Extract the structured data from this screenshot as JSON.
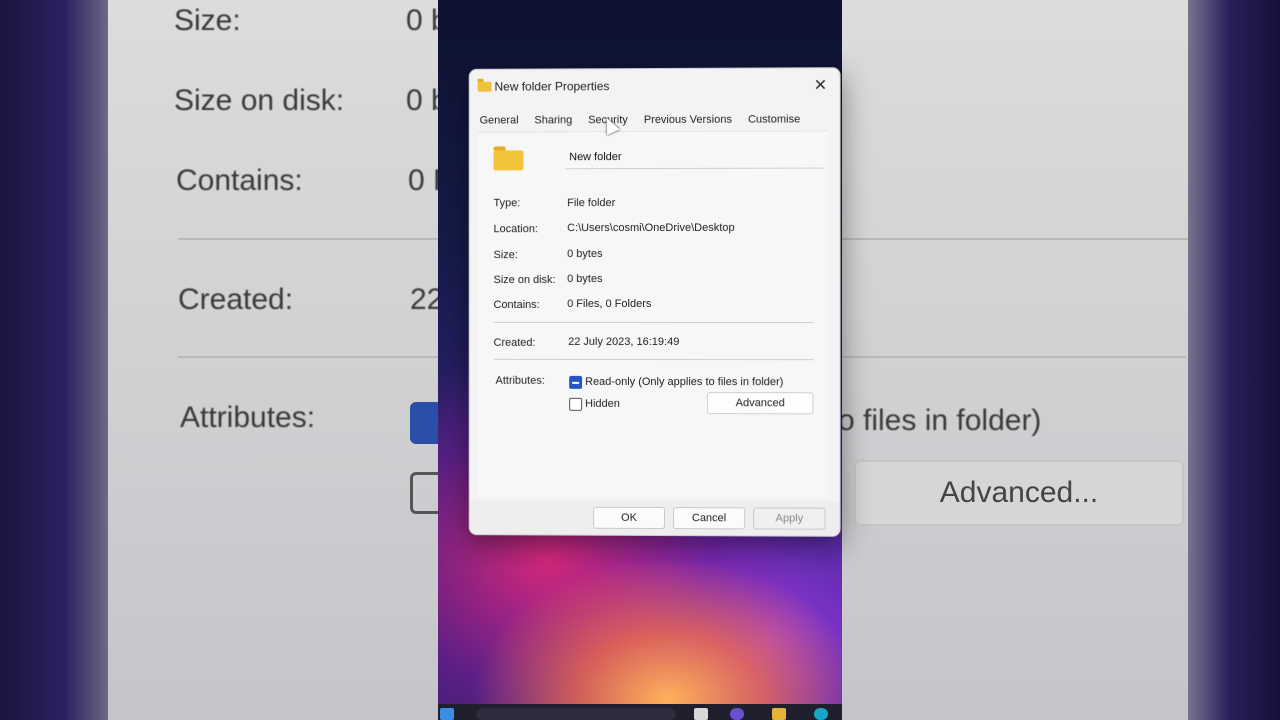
{
  "background_zoom": {
    "left": {
      "size_label": "Size:",
      "size_value": "0 b",
      "size_on_disk_label": "Size on disk:",
      "size_on_disk_value": "0 b",
      "contains_label": "Contains:",
      "contains_value": "0 F",
      "created_label": "Created:",
      "created_value": "22",
      "attributes_label": "Attributes:"
    },
    "right": {
      "readonly_tail": "o files in folder)",
      "advanced_label": "Advanced..."
    }
  },
  "dialog": {
    "title": "New folder Properties",
    "tabs": [
      {
        "label": "General",
        "active": true
      },
      {
        "label": "Sharing",
        "active": false
      },
      {
        "label": "Security",
        "active": false
      },
      {
        "label": "Previous Versions",
        "active": false
      },
      {
        "label": "Customise",
        "active": false
      }
    ],
    "name_value": "New folder",
    "type_label": "Type:",
    "type_value": "File folder",
    "location_label": "Location:",
    "location_value": "C:\\Users\\cosmi\\OneDrive\\Desktop",
    "size_label": "Size:",
    "size_value": "0 bytes",
    "size_on_disk_label": "Size on disk:",
    "size_on_disk_value": "0 bytes",
    "contains_label": "Contains:",
    "contains_value": "0 Files, 0 Folders",
    "created_label": "Created:",
    "created_value": "22 July 2023, 16:19:49",
    "attributes_label": "Attributes:",
    "readonly_label": "Read-only (Only applies to files in folder)",
    "readonly_state": "indeterminate",
    "hidden_label": "Hidden",
    "hidden_checked": false,
    "advanced_label": "Advanced",
    "ok_label": "OK",
    "cancel_label": "Cancel",
    "apply_label": "Apply"
  },
  "colors": {
    "accent": "#2457c5",
    "folder": "#f2c33b"
  }
}
